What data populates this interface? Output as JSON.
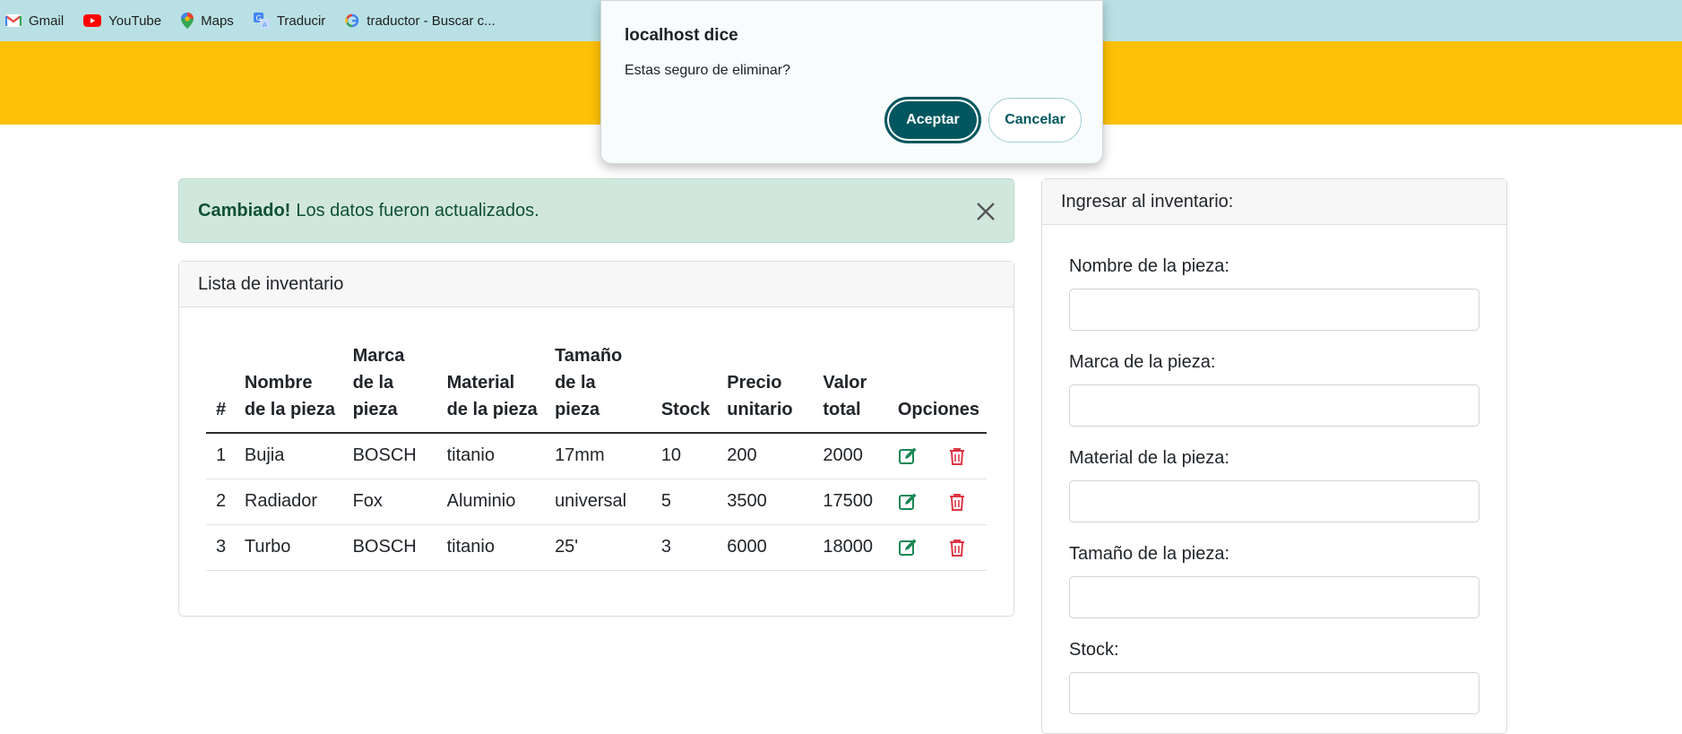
{
  "bookmarks": [
    {
      "label": "Gmail",
      "icon": "gmail-icon"
    },
    {
      "label": "YouTube",
      "icon": "youtube-icon"
    },
    {
      "label": "Maps",
      "icon": "maps-icon"
    },
    {
      "label": "Traducir",
      "icon": "translate-icon"
    },
    {
      "label": "traductor - Buscar c...",
      "icon": "google-icon"
    }
  ],
  "colors": {
    "banner": "#ffc107",
    "bookmarks_bar": "#b9e0e4",
    "alert_bg": "#d1e7dd",
    "alert_text": "#0f5132",
    "edit": "#198754",
    "delete": "#dc3545",
    "dialog_primary": "#00575f"
  },
  "alert": {
    "strong": "Cambiado!",
    "text": "Los datos fueron actualizados."
  },
  "list": {
    "title": "Lista de inventario",
    "headers": [
      [
        "#"
      ],
      [
        "Nombre",
        "de la pieza"
      ],
      [
        "Marca",
        "de la",
        "pieza"
      ],
      [
        "Material",
        "de la pieza"
      ],
      [
        "Tamaño",
        "de la pieza"
      ],
      [
        "Stock"
      ],
      [
        "Precio",
        "unitario"
      ],
      [
        "Valor",
        "total"
      ],
      [
        "Opciones"
      ]
    ],
    "rows": [
      {
        "id": "1",
        "nombre": "Bujia",
        "marca": "BOSCH",
        "material": "titanio",
        "tamano": "17mm",
        "stock": "10",
        "precio": "200",
        "valor": "2000"
      },
      {
        "id": "2",
        "nombre": "Radiador",
        "marca": "Fox",
        "material": "Aluminio",
        "tamano": "universal",
        "stock": "5",
        "precio": "3500",
        "valor": "17500"
      },
      {
        "id": "3",
        "nombre": "Turbo",
        "marca": "BOSCH",
        "material": "titanio",
        "tamano": "25'",
        "stock": "3",
        "precio": "6000",
        "valor": "18000"
      }
    ]
  },
  "form": {
    "title": "Ingresar al inventario:",
    "fields": [
      {
        "label": "Nombre de la pieza:",
        "value": ""
      },
      {
        "label": "Marca de la pieza:",
        "value": ""
      },
      {
        "label": "Material de la pieza:",
        "value": ""
      },
      {
        "label": "Tamaño de la pieza:",
        "value": ""
      },
      {
        "label": "Stock:",
        "value": ""
      }
    ]
  },
  "dialog": {
    "title": "localhost dice",
    "message": "Estas seguro de eliminar?",
    "ok_label": "Aceptar",
    "cancel_label": "Cancelar"
  }
}
